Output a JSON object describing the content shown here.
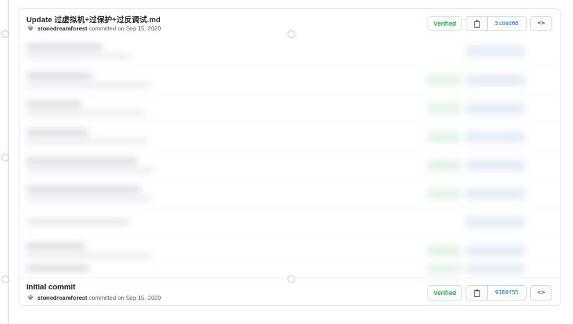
{
  "commits": [
    {
      "message": "Update 过虚拟机+过保护+过反调试.md",
      "author": "stonedreamforest",
      "committed_text": "committed on Sep 15, 2020",
      "verified": "Verified",
      "sha": "5cded68",
      "browse": "<>"
    },
    {
      "message": "Initial commit",
      "author": "stonedreamforest",
      "committed_text": "committed on Sep 15, 2020",
      "verified": "Verified",
      "sha": "9180f55",
      "browse": "<>"
    }
  ],
  "icons": {
    "copy": "clipboard-icon",
    "browse": "code-icon",
    "avatar": "avatar-icon"
  },
  "colors": {
    "verified": "#28a745",
    "sha_link": "#0366d6",
    "border": "#e1e4e8"
  }
}
